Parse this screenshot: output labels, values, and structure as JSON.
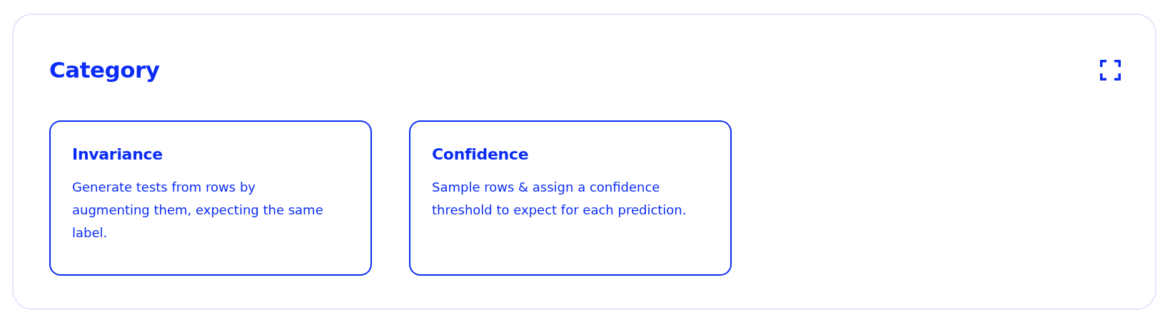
{
  "panel": {
    "title": "Category"
  },
  "cards": [
    {
      "title": "Invariance",
      "description": "Generate tests from rows by augmenting them, expecting the same label."
    },
    {
      "title": "Confidence",
      "description": "Sample rows & assign a confidence threshold to expect for each prediction."
    }
  ]
}
